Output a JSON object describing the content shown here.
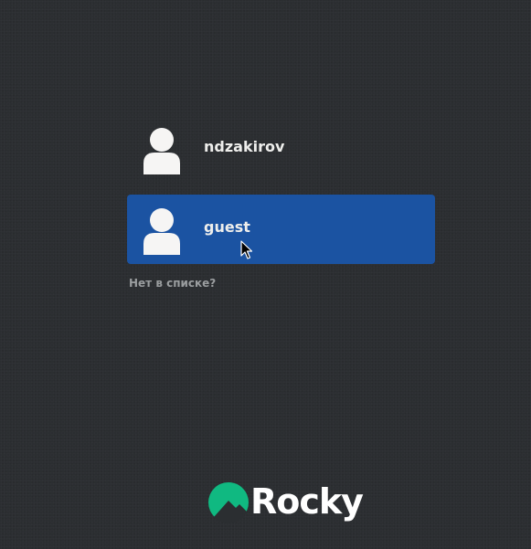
{
  "users": [
    {
      "name": "ndzakirov",
      "selected": false
    },
    {
      "name": "guest",
      "selected": true
    }
  ],
  "not_listed_label": "Нет в списке?",
  "brand": {
    "name": "Rocky",
    "accent_color": "#10b981"
  },
  "icons": {
    "avatar": "user-silhouette-icon",
    "cursor": "mouse-pointer-icon",
    "logo": "rocky-linux-logo-icon"
  },
  "colors": {
    "background": "#2b2e31",
    "selection": "#1b53a2",
    "text": "#eeeeec",
    "muted_text": "#9a9d9f"
  }
}
